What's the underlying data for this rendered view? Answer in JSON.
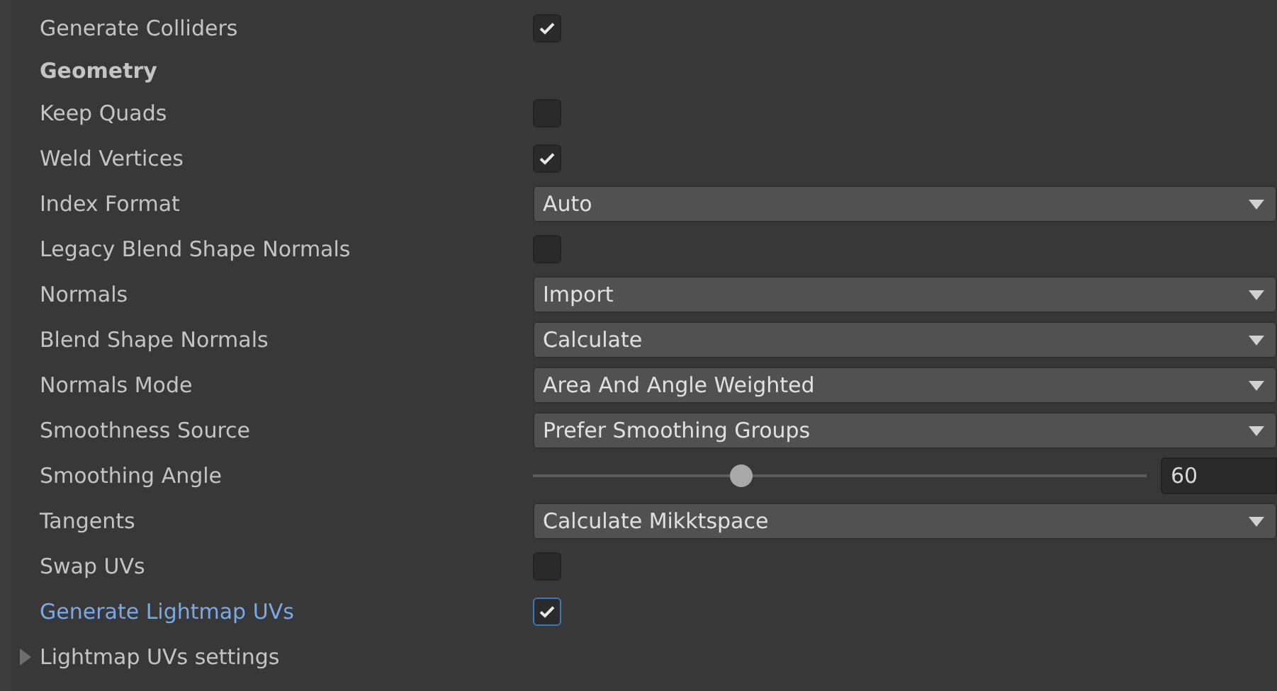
{
  "rows": [
    {
      "kind": "checkbox",
      "label": "Generate Colliders",
      "checked": true,
      "focused": false
    },
    {
      "kind": "header",
      "label": "Geometry"
    },
    {
      "kind": "checkbox",
      "label": "Keep Quads",
      "checked": false,
      "focused": false
    },
    {
      "kind": "checkbox",
      "label": "Weld Vertices",
      "checked": true,
      "focused": false
    },
    {
      "kind": "dropdown",
      "label": "Index Format",
      "value": "Auto"
    },
    {
      "kind": "checkbox",
      "label": "Legacy Blend Shape Normals",
      "checked": false,
      "focused": false
    },
    {
      "kind": "dropdown",
      "label": "Normals",
      "value": "Import"
    },
    {
      "kind": "dropdown",
      "label": "Blend Shape Normals",
      "value": "Calculate"
    },
    {
      "kind": "dropdown",
      "label": "Normals Mode",
      "value": "Area And Angle Weighted"
    },
    {
      "kind": "dropdown",
      "label": "Smoothness Source",
      "value": "Prefer Smoothing Groups"
    },
    {
      "kind": "slider",
      "label": "Smoothing Angle",
      "level": 0.34,
      "value": "60"
    },
    {
      "kind": "dropdown",
      "label": "Tangents",
      "value": "Calculate Mikktspace"
    },
    {
      "kind": "checkbox",
      "label": "Swap UVs",
      "checked": false,
      "focused": false
    },
    {
      "kind": "checkbox",
      "label": "Generate Lightmap UVs",
      "checked": true,
      "focused": true
    },
    {
      "kind": "foldout",
      "label": "Lightmap UVs settings",
      "expanded": false
    }
  ]
}
